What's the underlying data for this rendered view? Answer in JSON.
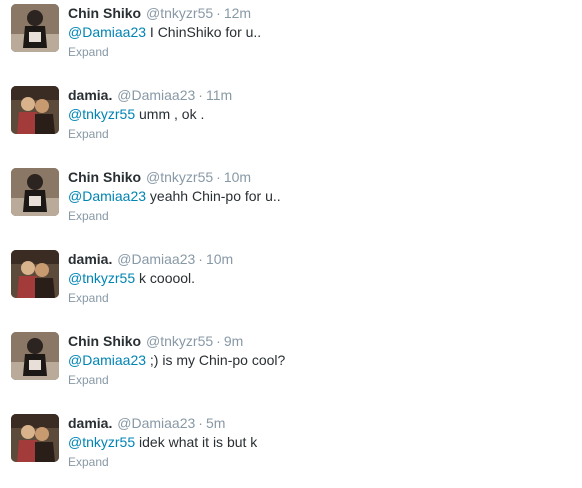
{
  "tweets": [
    {
      "fullname": "Chin Shiko",
      "username": "@tnkyzr55",
      "separator": "·",
      "time": "12m",
      "mention": "@Damiaa23",
      "text": " I ChinShiko for u..",
      "expand": "Expand",
      "avatar_icon": "profile-photo-chin-shiko"
    },
    {
      "fullname": "damia.",
      "username": "@Damiaa23",
      "separator": "·",
      "time": "11m",
      "mention": "@tnkyzr55",
      "text": " umm , ok .",
      "expand": "Expand",
      "avatar_icon": "profile-photo-damia"
    },
    {
      "fullname": "Chin Shiko",
      "username": "@tnkyzr55",
      "separator": "·",
      "time": "10m",
      "mention": "@Damiaa23",
      "text": " yeahh Chin-po for u..",
      "expand": "Expand",
      "avatar_icon": "profile-photo-chin-shiko"
    },
    {
      "fullname": "damia.",
      "username": "@Damiaa23",
      "separator": "·",
      "time": "10m",
      "mention": "@tnkyzr55",
      "text": " k cooool.",
      "expand": "Expand",
      "avatar_icon": "profile-photo-damia"
    },
    {
      "fullname": "Chin Shiko",
      "username": "@tnkyzr55",
      "separator": "·",
      "time": "9m",
      "mention": "@Damiaa23",
      "text": " ;) is my Chin-po cool?",
      "expand": "Expand",
      "avatar_icon": "profile-photo-chin-shiko"
    },
    {
      "fullname": "damia.",
      "username": "@Damiaa23",
      "separator": "·",
      "time": "5m",
      "mention": "@tnkyzr55",
      "text": " idek what it is but k",
      "expand": "Expand",
      "avatar_icon": "profile-photo-damia"
    }
  ],
  "colors": {
    "link": "#0084b4",
    "meta": "#8899a6",
    "text": "#292f33"
  }
}
